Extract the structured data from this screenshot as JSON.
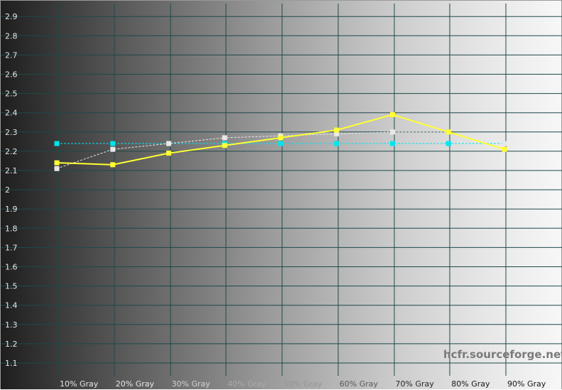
{
  "chart_data": {
    "type": "line",
    "title": "",
    "xlabel": "",
    "ylabel": "",
    "categories": [
      "10% Gray",
      "20% Gray",
      "30% Gray",
      "40% Gray",
      "50% Gray",
      "60% Gray",
      "70% Gray",
      "80% Gray",
      "90% Gray"
    ],
    "ylim": [
      1.0,
      2.95
    ],
    "yticks": [
      "2.9",
      "2.8",
      "2.7",
      "2.6",
      "2.5",
      "2.4",
      "2.3",
      "2.2",
      "2.1",
      "2",
      "1.9",
      "1.8",
      "1.7",
      "1.6",
      "1.5",
      "1.4",
      "1.3",
      "1.2",
      "1.1"
    ],
    "grid": true,
    "series": [
      {
        "color": "#ffff33",
        "style": "solid",
        "marker": "square",
        "values": [
          2.14,
          2.13,
          2.19,
          2.23,
          2.27,
          2.31,
          2.39,
          2.3,
          2.21
        ]
      },
      {
        "color": "#e8e8e8",
        "style": "dashed",
        "marker": "square",
        "values": [
          2.11,
          2.21,
          2.24,
          2.27,
          2.28,
          2.29,
          2.3,
          2.3,
          2.24
        ]
      },
      {
        "color": "#00e5ee",
        "style": "dashed",
        "marker": "square",
        "values": [
          2.24,
          2.24,
          2.24,
          2.24,
          2.24,
          2.24,
          2.24,
          2.24,
          2.24
        ]
      }
    ]
  },
  "watermark": "hcfr.sourceforge.net"
}
